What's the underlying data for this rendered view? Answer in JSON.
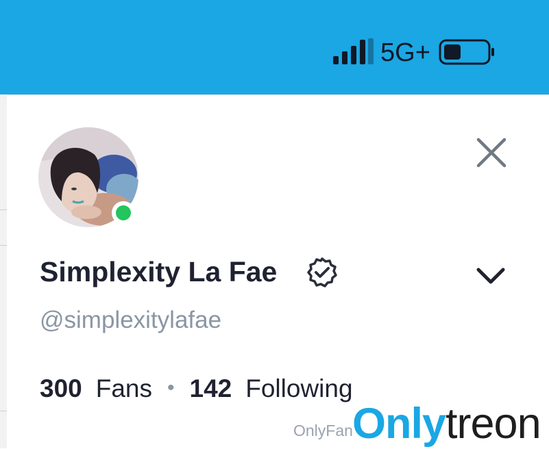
{
  "status_bar": {
    "network_type": "5G+",
    "accent_color": "#1aa7e4",
    "signal_icon": "signal-bars-icon",
    "battery_icon": "battery-icon"
  },
  "profile": {
    "display_name": "Simplexity La Fae",
    "username": "@simplexitylafae",
    "verified_icon": "verified-badge-icon",
    "online": true,
    "online_color": "#22c55e",
    "fans_count": "300",
    "fans_label": "Fans",
    "separator": "•",
    "following_count": "142",
    "following_label": "Following"
  },
  "actions": {
    "close_icon": "close-icon",
    "expand_icon": "chevron-down-icon"
  },
  "watermark": {
    "small_text": "OnlyFans",
    "logo_part1": "Only",
    "logo_part2": "treon"
  }
}
